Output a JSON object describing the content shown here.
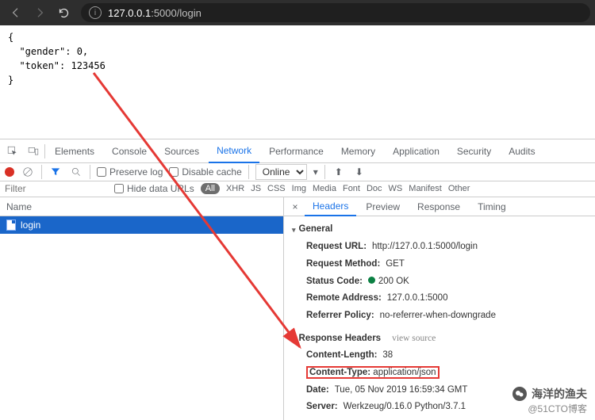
{
  "browser": {
    "url_host": "127.0.0.1",
    "url_port_path": ":5000/login"
  },
  "page_body": "{\n  \"gender\": 0,\n  \"token\": 123456\n}",
  "devtools": {
    "tabs": [
      "Elements",
      "Console",
      "Sources",
      "Network",
      "Performance",
      "Memory",
      "Application",
      "Security",
      "Audits"
    ],
    "active_tab": "Network",
    "preserve_log": "Preserve log",
    "disable_cache": "Disable cache",
    "online": "Online",
    "filter_placeholder": "Filter",
    "hide_data_urls": "Hide data URLs",
    "filter_types": [
      "All",
      "XHR",
      "JS",
      "CSS",
      "Img",
      "Media",
      "Font",
      "Doc",
      "WS",
      "Manifest",
      "Other"
    ],
    "left_header": "Name",
    "request_name": "login",
    "right_tabs": [
      "Headers",
      "Preview",
      "Response",
      "Timing"
    ],
    "general_label": "General",
    "general": {
      "request_url_k": "Request URL:",
      "request_url_v": "http://127.0.0.1:5000/login",
      "request_method_k": "Request Method:",
      "request_method_v": "GET",
      "status_code_k": "Status Code:",
      "status_code_v": "200 OK",
      "remote_addr_k": "Remote Address:",
      "remote_addr_v": "127.0.0.1:5000",
      "referrer_k": "Referrer Policy:",
      "referrer_v": "no-referrer-when-downgrade"
    },
    "resp_hdr_label": "Response Headers",
    "view_source": "view source",
    "resp": {
      "cl_k": "Content-Length:",
      "cl_v": "38",
      "ct_k": "Content-Type:",
      "ct_v": "application/json",
      "date_k": "Date:",
      "date_v": "Tue, 05 Nov 2019 16:59:34 GMT",
      "server_k": "Server:",
      "server_v": "Werkzeug/0.16.0 Python/3.7.1"
    }
  },
  "watermark": {
    "title": "海洋的渔夫",
    "sub": "@51CTO博客"
  }
}
